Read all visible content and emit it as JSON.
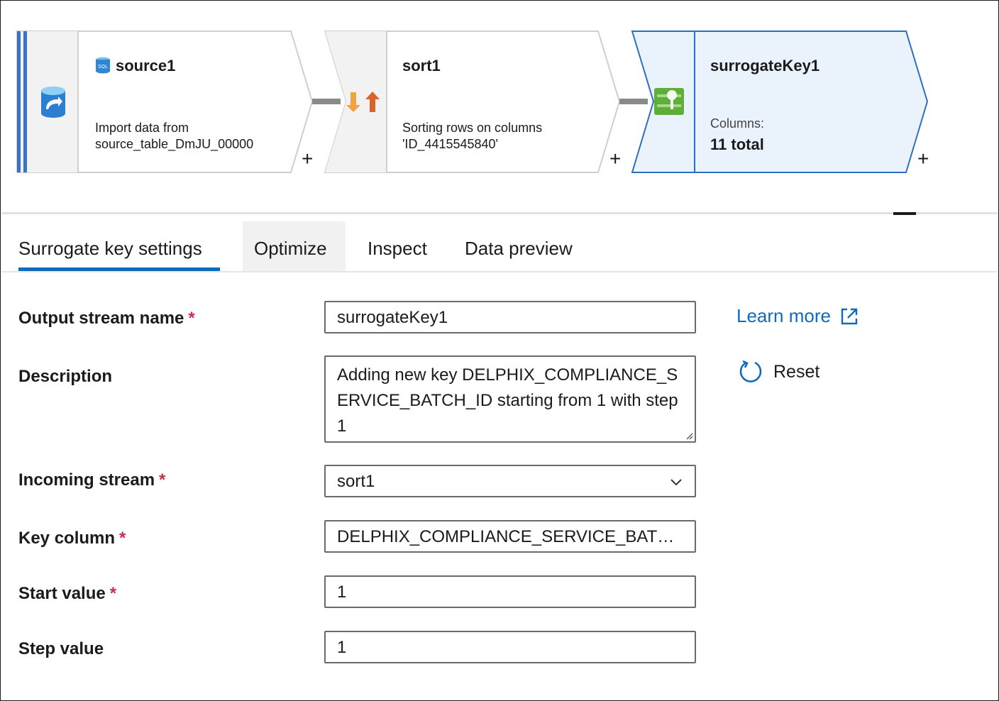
{
  "pipeline": {
    "nodes": [
      {
        "title": "source1",
        "description_line1": "Import data from",
        "description_line2": "source_table_DmJU_00000",
        "icon": "sql-database-icon",
        "plus": "+"
      },
      {
        "title": "sort1",
        "description_line1": "Sorting rows on columns",
        "description_line2": "'ID_4415545840'",
        "icon": "sort-arrows-icon",
        "plus": "+"
      },
      {
        "title": "surrogateKey1",
        "description_line1": "Columns:",
        "description_line2": "11 total",
        "icon": "surrogate-key-icon",
        "plus": "+"
      }
    ]
  },
  "tabs": [
    {
      "label": "Surrogate key settings",
      "active": true
    },
    {
      "label": "Optimize",
      "active": false
    },
    {
      "label": "Inspect",
      "active": false
    },
    {
      "label": "Data preview",
      "active": false
    }
  ],
  "form": {
    "required_mark": "*",
    "output_stream_name": {
      "label": "Output stream name",
      "value": "surrogateKey1"
    },
    "description": {
      "label": "Description",
      "value": "Adding new key DELPHIX_COMPLIANCE_SERVICE_BATCH_ID starting from 1 with step 1"
    },
    "incoming_stream": {
      "label": "Incoming stream",
      "value": "sort1"
    },
    "key_column": {
      "label": "Key column",
      "value": "DELPHIX_COMPLIANCE_SERVICE_BATCH_ID"
    },
    "start_value": {
      "label": "Start value",
      "value": "1"
    },
    "step_value": {
      "label": "Step value",
      "value": "1"
    }
  },
  "links": {
    "learn_more": "Learn more",
    "reset": "Reset"
  },
  "colors": {
    "accent": "#0f6cbd",
    "required": "#c4314b",
    "selected_node_fill": "#eaf2fb",
    "sort_orange": "#e8742a",
    "key_green": "#6db33f"
  }
}
